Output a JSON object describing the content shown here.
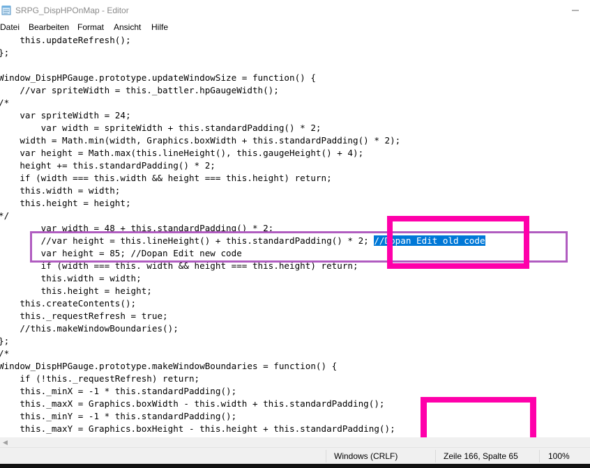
{
  "window": {
    "title": "SRPG_DispHPOnMap - Editor"
  },
  "menu": [
    "Datei",
    "Bearbeiten",
    "Format",
    "Ansicht",
    "Hilfe"
  ],
  "code_lines": [
    "    this.updateRefresh();",
    "};",
    "",
    "Window_DispHPGauge.prototype.updateWindowSize = function() {",
    "    //var spriteWidth = this._battler.hpGaugeWidth();",
    "/*",
    "    var spriteWidth = 24;",
    "        var width = spriteWidth + this.standardPadding() * 2;",
    "    width = Math.min(width, Graphics.boxWidth + this.standardPadding() * 2);",
    "    var height = Math.max(this.lineHeight(), this.gaugeHeight() + 4);",
    "    height += this.standardPadding() * 2;",
    "    if (width === this.width && height === this.height) return;",
    "    this.width = width;",
    "    this.height = height;",
    "*/",
    "        var width = 48 + this.standardPadding() * 2;",
    {
      "before": "        //var height = this.lineHeight() + this.standardPadding() * 2; ",
      "selected": "//Dopan Edit old code"
    },
    "        var height = 85; //Dopan Edit new code",
    "        if (width === this. width && height === this.height) return;",
    "        this.width = width;",
    "        this.height = height;",
    "    this.createContents();",
    "    this._requestRefresh = true;",
    "    //this.makeWindowBoundaries();",
    "};",
    "/*",
    "Window_DispHPGauge.prototype.makeWindowBoundaries = function() {",
    "    if (!this._requestRefresh) return;",
    "    this._minX = -1 * this.standardPadding();",
    "    this._maxX = Graphics.boxWidth - this.width + this.standardPadding();",
    "    this._minY = -1 * this.standardPadding();",
    "    this._maxY = Graphics.boxHeight - this.height + this.standardPadding();"
  ],
  "status": {
    "line_ending": "Windows (CRLF)",
    "position": "Zeile 166, Spalte 65",
    "zoom": "100%"
  },
  "colors": {
    "selection": "#0078d7",
    "highlight_pink": "#ff00aa",
    "highlight_purple": "#b05cc0"
  }
}
